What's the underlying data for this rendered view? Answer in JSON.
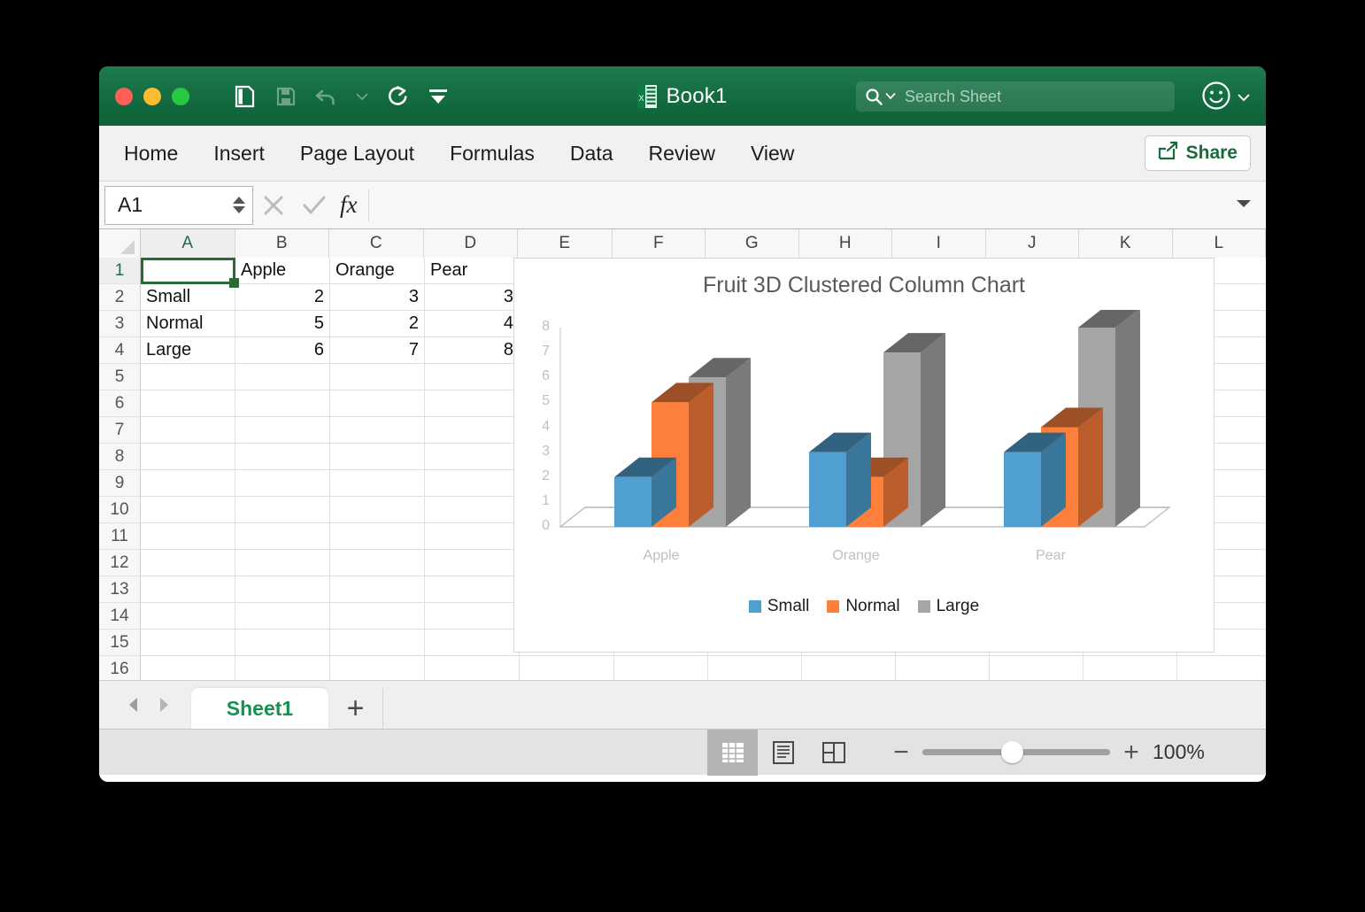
{
  "window": {
    "title": "Book1",
    "traffic_lights": [
      "close",
      "minimize",
      "maximize"
    ]
  },
  "titlebar": {
    "icons": [
      "sidebar-toggle-icon",
      "save-icon",
      "undo-icon",
      "undo-dropdown-icon",
      "redo-icon",
      "customize-toolbar-icon"
    ],
    "search": {
      "placeholder": "Search Sheet",
      "value": ""
    },
    "smiley_label": "☺"
  },
  "ribbon": {
    "tabs": [
      "Home",
      "Insert",
      "Page Layout",
      "Formulas",
      "Data",
      "Review",
      "View"
    ],
    "active_tab": "Home",
    "share_label": "Share"
  },
  "formula_bar": {
    "name_box": "A1",
    "cancel_label": "✕",
    "accept_label": "✓",
    "fx_label": "fx",
    "formula_value": "",
    "formula_placeholder": ""
  },
  "grid": {
    "columns": [
      "A",
      "B",
      "C",
      "D",
      "E",
      "F",
      "G",
      "H",
      "I",
      "J",
      "K",
      "L"
    ],
    "rows": [
      "1",
      "2",
      "3",
      "4",
      "5",
      "6",
      "7",
      "8",
      "9",
      "10",
      "11",
      "12",
      "13",
      "14",
      "15",
      "16"
    ],
    "selected_cell": "A1",
    "cells": [
      [
        "",
        "Apple",
        "Orange",
        "Pear",
        "",
        "",
        "",
        "",
        "",
        "",
        "",
        ""
      ],
      [
        "Small",
        "2",
        "3",
        "3",
        "",
        "",
        "",
        "",
        "",
        "",
        "",
        ""
      ],
      [
        "Normal",
        "5",
        "2",
        "4",
        "",
        "",
        "",
        "",
        "",
        "",
        "",
        ""
      ],
      [
        "Large",
        "6",
        "7",
        "8",
        "",
        "",
        "",
        "",
        "",
        "",
        "",
        ""
      ]
    ]
  },
  "chart_data": {
    "type": "bar",
    "title": "Fruit 3D Clustered Column Chart",
    "subtitle": "",
    "xlabel": "",
    "ylabel": "",
    "categories": [
      "Apple",
      "Orange",
      "Pear"
    ],
    "series": [
      {
        "name": "Small",
        "values": [
          2,
          3,
          3
        ],
        "color": "#4f9fd0"
      },
      {
        "name": "Normal",
        "values": [
          5,
          2,
          4
        ],
        "color": "#fd7f3b"
      },
      {
        "name": "Large",
        "values": [
          6,
          7,
          8
        ],
        "color": "#a5a5a5"
      }
    ],
    "yticks": [
      "8",
      "7",
      "6",
      "5",
      "4",
      "3",
      "2",
      "1",
      "0"
    ],
    "ylim": [
      0,
      8
    ],
    "grid": false,
    "legend_position": "bottom",
    "three_d": true
  },
  "sheet_tabs": {
    "prev_label": "◀",
    "next_label": "▶",
    "tabs": [
      "Sheet1"
    ],
    "active": "Sheet1",
    "add_label": "+"
  },
  "status_bar": {
    "views": [
      "normal-view",
      "page-layout-view",
      "page-break-view"
    ],
    "active_view": "normal-view",
    "zoom_minus": "−",
    "zoom_plus": "+",
    "zoom_value": "100%"
  },
  "colors": {
    "brand_green": "#136b40",
    "accent_green": "#1d6f42",
    "series_blue": "#4f9fd0",
    "series_orange": "#fd7f3b",
    "series_gray": "#a5a5a5"
  }
}
